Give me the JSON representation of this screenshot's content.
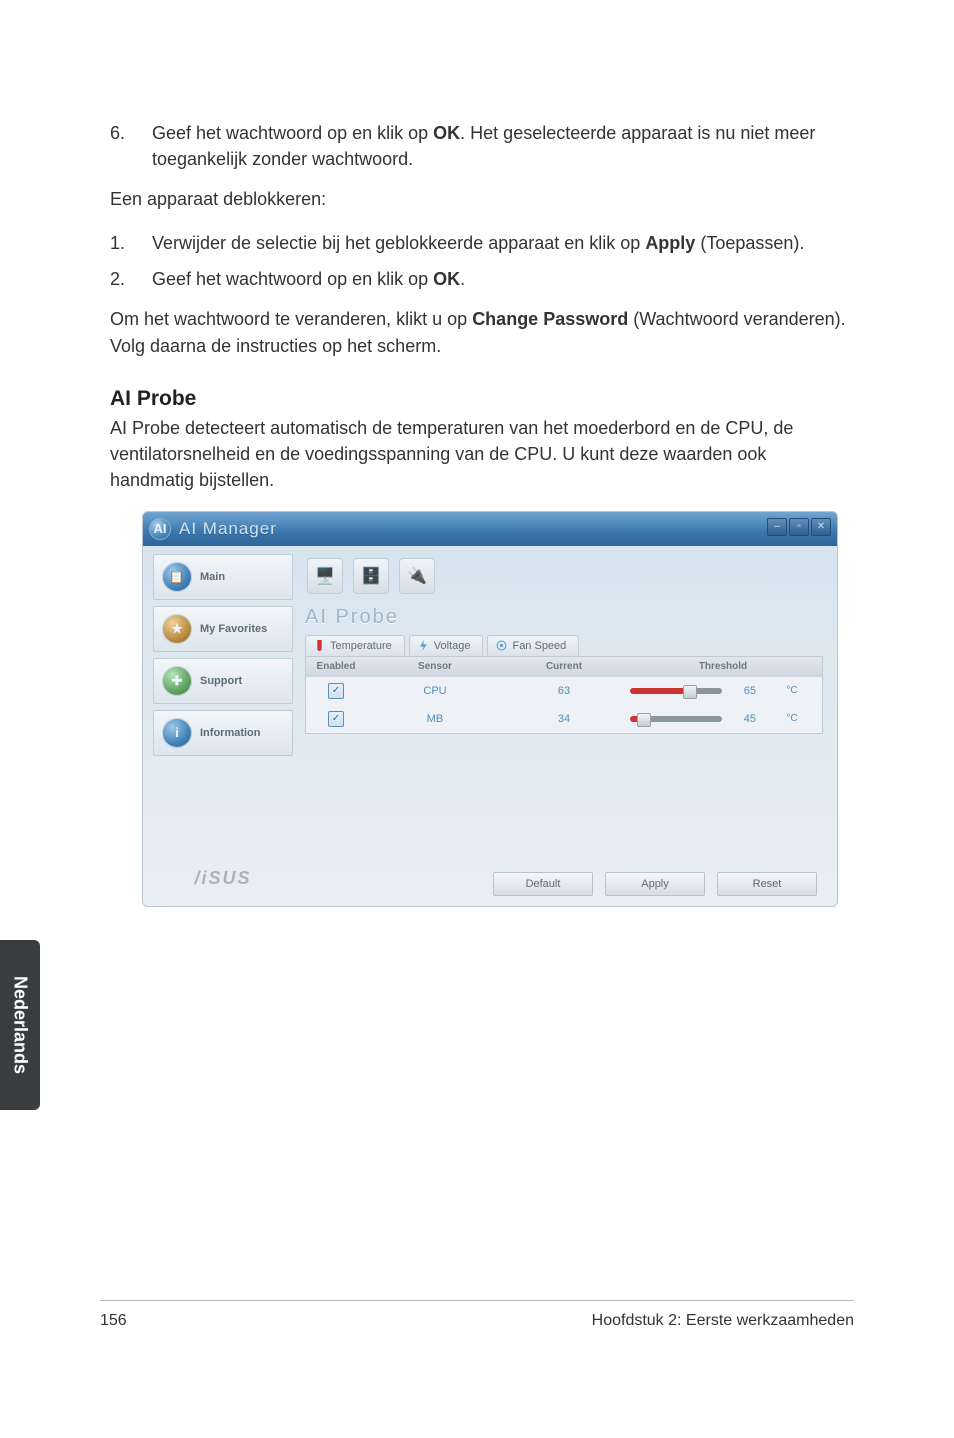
{
  "doc": {
    "list1_num": "6.",
    "list1_pre": "Geef het wachtwoord op en klik op ",
    "list1_b": "OK",
    "list1_post": ". Het geselecteerde apparaat is nu niet meer toegankelijk zonder wachtwoord.",
    "deblok": "Een apparaat deblokkeren:",
    "s1_num": "1.",
    "s1_pre": " Verwijder de selectie bij het geblokkeerde apparaat en klik op ",
    "s1_b": "Apply",
    "s1_post": " (Toepassen).",
    "s2_num": "2.",
    "s2_pre": "Geef het wachtwoord op en klik op ",
    "s2_b": "OK",
    "s2_post": ".",
    "change_pre": "Om het wachtwoord te veranderen, klikt u op ",
    "change_b": "Change Password",
    "change_post": " (Wachtwoord veranderen). Volg daarna de instructies op het scherm.",
    "h3": "AI Probe",
    "h3_body": "AI Probe detecteert automatisch de temperaturen van het moederbord en de CPU, de ventilatorsnelheid en de voedingsspanning van de CPU. U kunt deze waarden ook handmatig bijstellen."
  },
  "ui": {
    "title": "AI Manager",
    "sidebar": [
      "Main",
      "My Favorites",
      "Support",
      "Information"
    ],
    "brand": "/iSUS",
    "panel_title": "AI Probe",
    "tabs": [
      "Temperature",
      "Voltage",
      "Fan Speed"
    ],
    "columns": {
      "enabled": "Enabled",
      "sensor": "Sensor",
      "current": "Current",
      "threshold": "Threshold"
    },
    "rows": [
      {
        "sensor": "CPU",
        "current": "63",
        "threshold": "65",
        "unit": "°C",
        "pct": 58
      },
      {
        "sensor": "MB",
        "current": "34",
        "threshold": "45",
        "unit": "°C",
        "pct": 8
      }
    ],
    "buttons": {
      "default": "Default",
      "apply": "Apply",
      "reset": "Reset"
    }
  },
  "footer": {
    "page": "156",
    "chapter": "Hoofdstuk 2: Eerste werkzaamheden",
    "lang": "Nederlands"
  }
}
